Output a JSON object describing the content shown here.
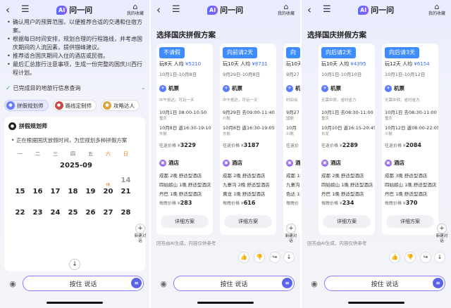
{
  "app": {
    "back_icon": "back-arrow-icon",
    "menu_icon": "list-menu-icon",
    "logo_badge": "AI",
    "name": "问一问",
    "fav_label": "我的收藏",
    "input_text": "按住 说话",
    "new_chat_label": "新建对话"
  },
  "phone1": {
    "bullets": [
      "确认用户的预算范围，以便推荐合适的交通和住宿方",
      "案。",
      "根据每日时间安排，规划合理的行程路线，并考虑国",
      "庆期间的人流因素，提供错峰建议。",
      "推荐适合国庆期间入住的酒店或民宿。",
      "最后汇总旅行注意事项，生成一份完整的国庆川西行",
      "程计划。"
    ],
    "done_text": "已完成目的地旅行信息查询",
    "agents": [
      "拼假规划师",
      "路线定制师",
      "攻略达人"
    ],
    "plan_title": "拼假规划师",
    "plan_status": "正在根据国庆放假时间，为您规划多种拼假方案",
    "calendar": {
      "weekdays": [
        "一",
        "二",
        "三",
        "四",
        "五",
        "六",
        "日"
      ],
      "month": "2025-09",
      "rows": [
        [
          "15",
          "16",
          "17",
          "18",
          "19",
          "20",
          "21"
        ],
        [
          "22",
          "23",
          "24",
          "25",
          "26",
          "27",
          "28"
        ]
      ],
      "row0_partial": [
        "",
        "",
        "",
        "",
        "",
        "",
        "14"
      ],
      "special_top": {
        "day": "20",
        "label": "休"
      }
    }
  },
  "plans_title": "选择国庆拼假方案",
  "phone2": {
    "cards": [
      {
        "tag": "不请假",
        "summary_a": "玩8天 人均 ",
        "summary_price": "¥5210",
        "dates": "10月1日-10月8日",
        "flight_title": "机票",
        "flight_note": "中午抵达，可玩一天",
        "out": "10月1日 08:00-10:50",
        "out_code": "重庆",
        "ret": "10月8日 返16:30-19:10",
        "ret_code": "东航",
        "flight_price_label": "往返价格 ¥",
        "flight_price": "3229",
        "hotel_title": "酒店",
        "hotels": [
          "成都 2晚 舒适型酒店",
          "四姑娘山 1晚 舒适型酒店",
          "丹巴 1晚 舒适型酒店"
        ],
        "hotel_price_label": "每晚价格 ¥",
        "hotel_price": "283",
        "more": "详细方案"
      },
      {
        "tag": "向前请2天",
        "summary_a": "玩10天 人均 ",
        "summary_price": "¥8731",
        "dates": "9月29日-10月8日",
        "flight_title": "机票",
        "flight_note": "中午抵达，可玩一天",
        "out": "9月29日 去09:00-11:40",
        "out_code": "川航",
        "ret": "10月8日 返16:30-19:05",
        "ret_code": "东航",
        "flight_price_label": "往返价格 ¥",
        "flight_price": "3187",
        "hotel_title": "酒店",
        "hotels": [
          "成都 2晚 舒适型酒店",
          "九寨沟 2晚 舒适型酒店",
          "黄龙 1晚 舒适型酒店"
        ],
        "hotel_price_label": "每晚价格 ¥",
        "hotel_price": "616",
        "more": "详细方案"
      },
      {
        "tag": "向",
        "summary_a": "玩10天 人均 ",
        "summary_price": "¥7",
        "dates": "9月27日",
        "flight_title": "机",
        "flight_note": "时间合",
        "out": "9月27 15:",
        "out_code": "国航",
        "ret": "10月",
        "ret_code": "川航",
        "flight_price_label": "往返价",
        "flight_price": "",
        "hotel_title": "酒",
        "hotels": [
          "成都 1晚",
          "九寨沟",
          "色达 1晚"
        ],
        "hotel_price_label": "每晚价",
        "hotel_price": "",
        "more": ""
      }
    ],
    "disclaimer": "回答由AI生成，内容仅供参考"
  },
  "phone3": {
    "cards": [
      {
        "tag": "向后请2天",
        "summary_a": "玩10天 人均 ",
        "summary_price": "¥4395",
        "dates": "10月1日-10月10日",
        "flight_title": "机票",
        "flight_note": "无需中转，省时省力",
        "out": "10月1日 去08:30-11:00",
        "out_code": "重庆",
        "ret": "10月10日 返16:15-20:45",
        "ret_code": "长龙",
        "flight_price_label": "往返价格 ¥",
        "flight_price": "2289",
        "hotel_title": "酒店",
        "hotels": [
          "成都 2晚 舒适型酒店",
          "四姑娘山 1晚 舒适型酒店",
          "丹巴 1晚 舒适型酒店"
        ],
        "hotel_price_label": "每晚价格 ¥",
        "hotel_price": "234",
        "more": "详细方案"
      },
      {
        "tag": "向后请3天",
        "summary_a": "玩12天 人均 ",
        "summary_price": "¥6154",
        "dates": "10月1日-10月12日",
        "flight_title": "机票",
        "flight_note": "无需中转，省时省力",
        "out": "10月1日 去08:30-11:00",
        "out_code": "重庆",
        "ret": "10月12日 返08:00-22:05",
        "ret_code": "川航",
        "flight_price_label": "往返价格 ¥",
        "flight_price": "2084",
        "hotel_title": "酒店",
        "hotels": [
          "成都 3晚 舒适型酒店",
          "四姑娘山 1晚 舒适型酒店",
          "丹巴 1晚 舒适型酒店"
        ],
        "hotel_price_label": "每晚价格 ¥",
        "hotel_price": "370",
        "more": "详细方案"
      }
    ],
    "disclaimer": "回答由AI生成，内容仅供参考"
  }
}
